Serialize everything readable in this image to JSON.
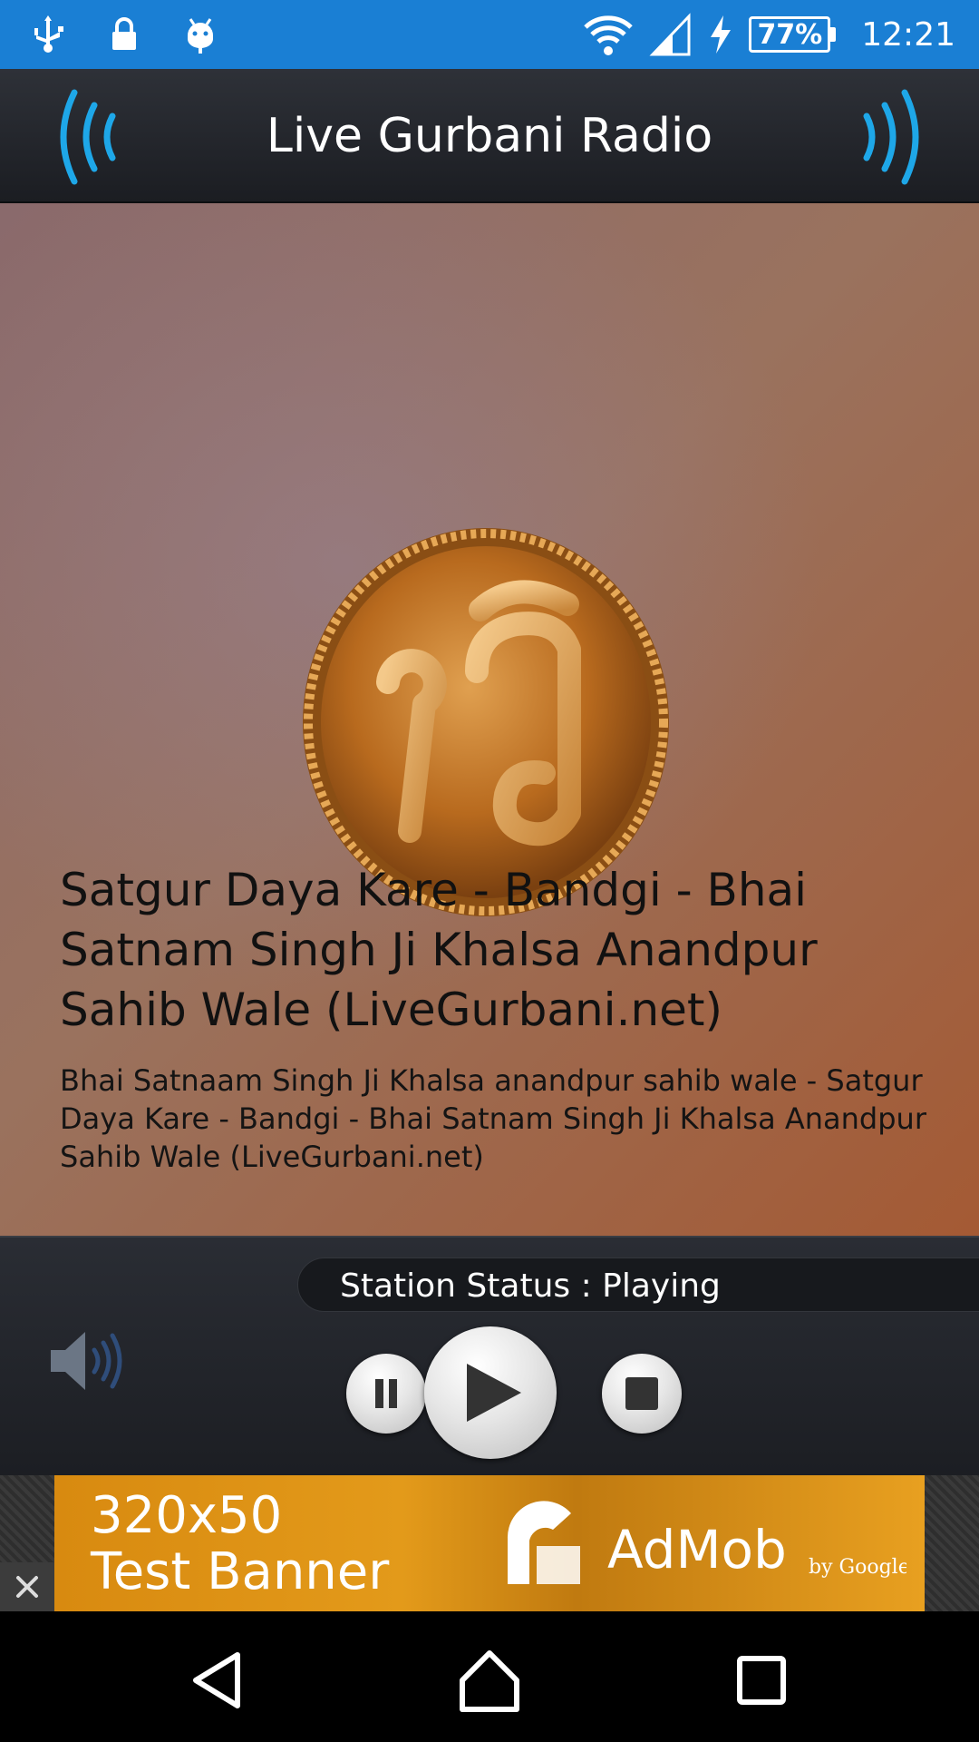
{
  "status_bar": {
    "battery": "77%",
    "time": "12:21",
    "icons": [
      "usb-icon",
      "lock-icon",
      "android-icon",
      "wifi-icon",
      "signal-icon",
      "charging-icon",
      "battery-icon"
    ]
  },
  "app": {
    "title": "Live Gurbani Radio",
    "accent_color": "#1ea7e8"
  },
  "now_playing": {
    "title": "Satgur Daya Kare - Bandgi - Bhai Satnam Singh Ji Khalsa Anandpur Sahib Wale (LiveGurbani.net)",
    "description": "Bhai Satnaam Singh Ji Khalsa anandpur sahib wale - Satgur Daya Kare - Bandgi - Bhai Satnam Singh Ji Khalsa Anandpur Sahib Wale (LiveGurbani.net)",
    "emblem": "ik-onkar-emblem"
  },
  "player": {
    "station_status": "Station Status : Playing",
    "controls": [
      "pause-icon",
      "play-icon",
      "stop-icon"
    ],
    "volume_icon": "speaker-icon"
  },
  "ad": {
    "size_text_line1": "320x50",
    "size_text_line2": "Test Banner",
    "brand": "AdMob",
    "brand_sub": "by Google"
  },
  "nav": [
    "back-icon",
    "home-icon",
    "recents-icon"
  ]
}
